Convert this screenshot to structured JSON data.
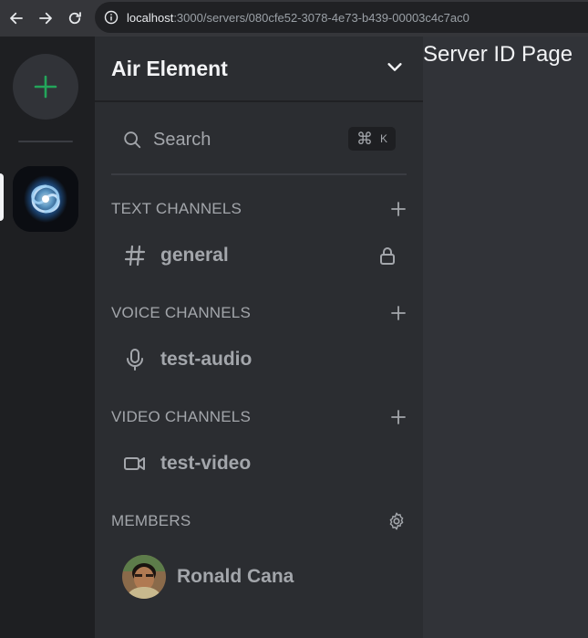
{
  "browser": {
    "url_host": "localhost",
    "url_rest": ":3000/servers/080cfe52-3078-4e73-b439-00003c4c7ac0"
  },
  "rail": {
    "add_server_icon": "plus-icon",
    "accent_color": "#23a55a"
  },
  "sidebar": {
    "server_name": "Air Element",
    "search": {
      "label": "Search",
      "shortcut_symbol": "⌘",
      "shortcut_key": "K"
    },
    "sections": {
      "text": {
        "title": "TEXT CHANNELS",
        "channels": [
          {
            "name": "general",
            "icon": "hash-icon",
            "locked": true
          }
        ]
      },
      "voice": {
        "title": "VOICE CHANNELS",
        "channels": [
          {
            "name": "test-audio",
            "icon": "mic-icon"
          }
        ]
      },
      "video": {
        "title": "VIDEO CHANNELS",
        "channels": [
          {
            "name": "test-video",
            "icon": "video-icon"
          }
        ]
      },
      "members": {
        "title": "MEMBERS",
        "items": [
          {
            "name": "Ronald Cana"
          }
        ]
      }
    }
  },
  "main": {
    "title": "Server ID Page"
  }
}
